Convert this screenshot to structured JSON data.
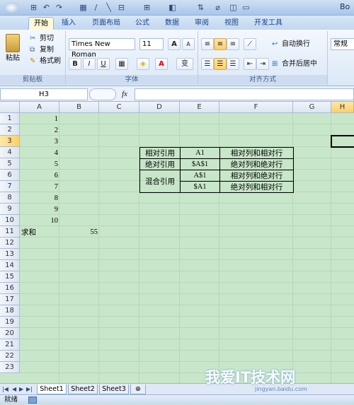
{
  "titlebar": {
    "title": "Bo",
    "quick": [
      "⊞",
      "↶",
      "↷",
      "▦",
      "∕",
      "╲",
      "⊟",
      "⊞",
      "◧",
      "⇅",
      "⌀",
      "◫",
      "▭"
    ]
  },
  "tabs": [
    {
      "label": "开始",
      "active": true
    },
    {
      "label": "插入",
      "active": false
    },
    {
      "label": "页面布局",
      "active": false
    },
    {
      "label": "公式",
      "active": false
    },
    {
      "label": "数据",
      "active": false
    },
    {
      "label": "审阅",
      "active": false
    },
    {
      "label": "视图",
      "active": false
    },
    {
      "label": "开发工具",
      "active": false
    }
  ],
  "ribbon": {
    "clipboard": {
      "paste": "粘贴",
      "cut": "剪切",
      "copy": "复制",
      "format_painter": "格式刷",
      "label": "剪贴板"
    },
    "font": {
      "name": "Times New Roman",
      "size": "11",
      "grow": "A",
      "shrink": "A",
      "bold": "B",
      "italic": "I",
      "underline": "U",
      "wen": "变",
      "label": "字体"
    },
    "alignment": {
      "wrap": "自动换行",
      "merge": "合并后居中",
      "label": "对齐方式"
    },
    "number": {
      "format": "常规"
    }
  },
  "formula_bar": {
    "name_box": "H3",
    "fx": "fx",
    "content": ""
  },
  "grid": {
    "columns": [
      "A",
      "B",
      "C",
      "D",
      "E",
      "F",
      "G",
      "H"
    ],
    "rows": [
      "1",
      "2",
      "3",
      "4",
      "5",
      "6",
      "7",
      "8",
      "9",
      "10",
      "11",
      "12",
      "13",
      "14",
      "15",
      "16",
      "17",
      "18",
      "19",
      "20",
      "21",
      "22",
      "23"
    ],
    "a_values": [
      "1",
      "2",
      "3",
      "4",
      "5",
      "6",
      "7",
      "8",
      "9",
      "10"
    ],
    "a11": "求和",
    "b11": "55",
    "table": {
      "d4": "相对引用",
      "e4": "A1",
      "f4": "相对列和相对行",
      "d5": "绝对引用",
      "e5": "$A$1",
      "f5": "绝对列和绝对行",
      "d6": "混合引用",
      "e6": "A$1",
      "f6": "相对列和绝对行",
      "e7": "$A1",
      "f7": "绝对列和相对行"
    }
  },
  "sheets": [
    "Sheet1",
    "Sheet2",
    "Sheet3"
  ],
  "status": {
    "ready": "就绪"
  },
  "watermark": {
    "text": "我爱IT技术网",
    "url": "jingyan.baidu.com"
  },
  "colors": {
    "grid_bg": "#c8e6c9",
    "ribbon_text": "#15428b"
  }
}
